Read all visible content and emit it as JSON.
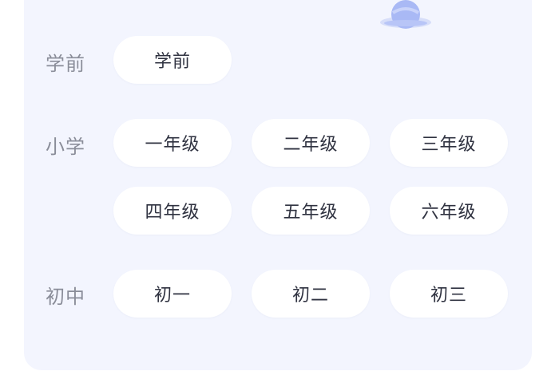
{
  "sections": [
    {
      "label": "学前",
      "options": [
        "学前"
      ]
    },
    {
      "label": "小学",
      "options": [
        "一年级",
        "二年级",
        "三年级",
        "四年级",
        "五年级",
        "六年级"
      ]
    },
    {
      "label": "初中",
      "options": [
        "初一",
        "初二",
        "初三"
      ]
    }
  ],
  "icons": {
    "planet": "planet-icon"
  },
  "colors": {
    "card_background": "#f3f5fe",
    "pill_background": "#ffffff",
    "label_text": "#8a8d99",
    "pill_text": "#2f3240",
    "planet_accent": "#9fb1f3"
  }
}
